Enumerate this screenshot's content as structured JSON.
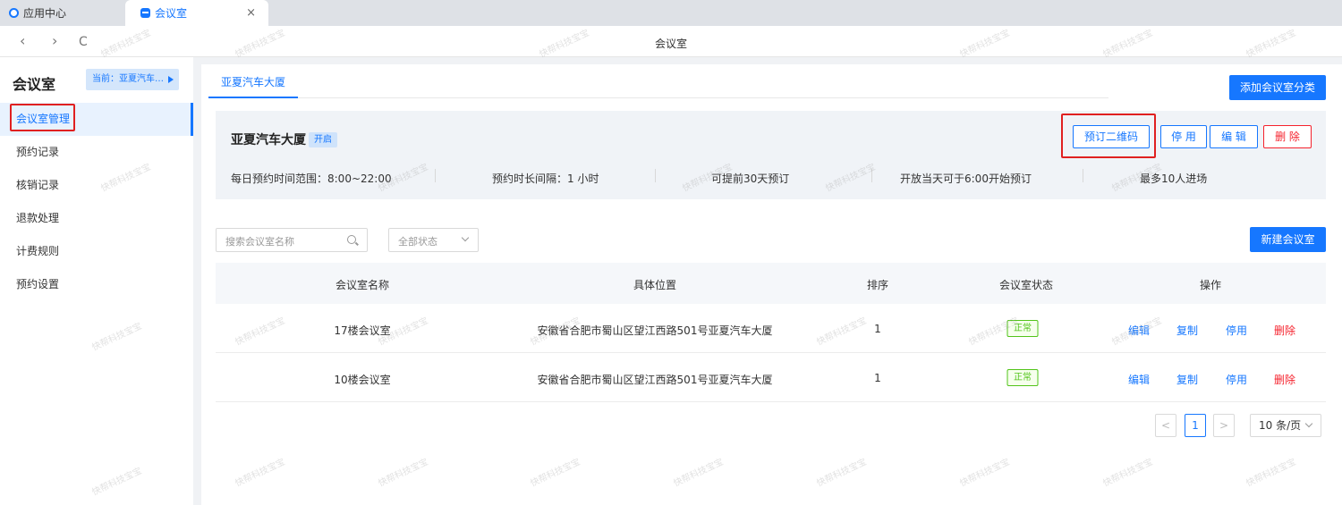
{
  "browser": {
    "tabs": [
      {
        "label": "应用中心"
      },
      {
        "label": "会议室"
      }
    ],
    "close_glyph": "×",
    "nav": {
      "back": "‹",
      "forward": "›",
      "reload": "C"
    },
    "page_title": "会议室"
  },
  "sidebar": {
    "title": "会议室",
    "current": "当前：亚夏汽车…",
    "items": [
      {
        "label": "会议室管理"
      },
      {
        "label": "预约记录"
      },
      {
        "label": "核销记录"
      },
      {
        "label": "退款处理"
      },
      {
        "label": "计费规则"
      },
      {
        "label": "预约设置"
      }
    ]
  },
  "main": {
    "tab": "亚夏汽车大厦",
    "add_category": "添加会议室分类",
    "building": {
      "name": "亚夏汽车大厦",
      "status": "开启",
      "buttons": {
        "qrcode": "预订二维码",
        "disable": "停 用",
        "edit": "编 辑",
        "delete": "删 除"
      },
      "info": {
        "time_range": "每日预约时间范围：8:00~22:00",
        "interval": "预约时长间隔：1 小时",
        "advance": "可提前30天预订",
        "open_time": "开放当天可于6:00开始预订",
        "max_people": "最多10人进场"
      }
    },
    "search_placeholder": "搜索会议室名称",
    "status_filter": "全部状态",
    "new_room": "新建会议室",
    "table": {
      "headers": [
        "会议室名称",
        "具体位置",
        "排序",
        "会议室状态",
        "操作"
      ],
      "rows": [
        {
          "name": "17楼会议室",
          "location": "安徽省合肥市蜀山区望江西路501号亚夏汽车大厦",
          "order": "1",
          "status": "正常"
        },
        {
          "name": "10楼会议室",
          "location": "安徽省合肥市蜀山区望江西路501号亚夏汽车大厦",
          "order": "1",
          "status": "正常"
        }
      ],
      "actions": {
        "edit": "编辑",
        "copy": "复制",
        "disable": "停用",
        "delete": "删除"
      }
    },
    "pagination": {
      "prev": "<",
      "current": "1",
      "next": ">",
      "page_size": "10 条/页"
    }
  },
  "watermark": "快帮科技宝宝",
  "colors": {
    "primary": "#1677ff",
    "danger": "#f5222d",
    "success": "#52c41a",
    "highlight": "#e02020"
  }
}
